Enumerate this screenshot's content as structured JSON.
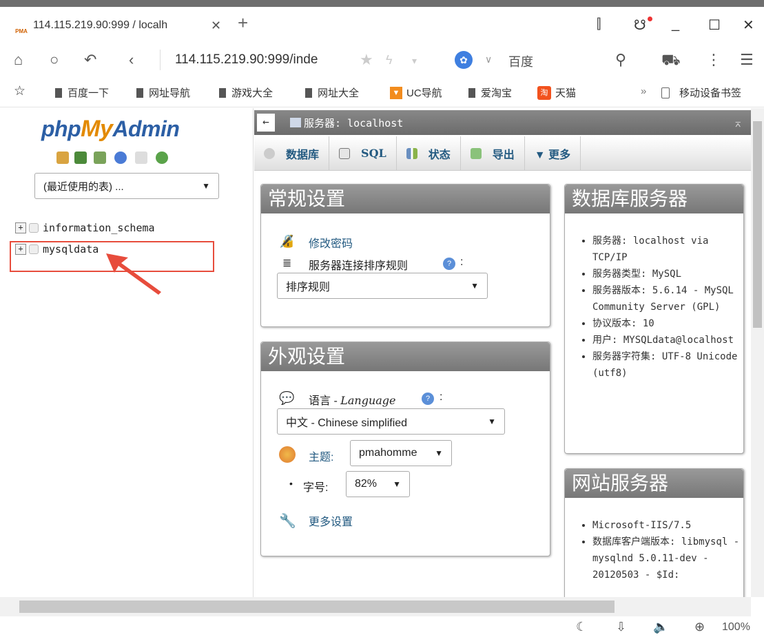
{
  "browser": {
    "tab_title": "114.115.219.90:999 / localh",
    "tab_favicon_text": "PMA",
    "url": "114.115.219.90:999/inde",
    "search_engine": "百度",
    "bookmarks": [
      "百度一下",
      "网址导航",
      "游戏大全",
      "网址大全",
      "UC导航",
      "爱淘宝",
      "天猫"
    ],
    "bookmarks_more": "»",
    "mobile_bookmarks": "移动设备书签",
    "zoom": "100%"
  },
  "sidebar": {
    "logo_php": "php",
    "logo_my": "My",
    "logo_admin": "Admin",
    "recent_tables": "(最近使用的表) ...",
    "databases": [
      "information_schema",
      "mysqldata"
    ]
  },
  "breadcrumb": {
    "back": "←",
    "server": "服务器: localhost"
  },
  "menu": {
    "tabs": [
      "数据库",
      "SQL",
      "状态",
      "导出"
    ],
    "more": "▼ 更多"
  },
  "general_settings": {
    "title": "常规设置",
    "change_password": "修改密码",
    "collation_label": "服务器连接排序规则",
    "collation_value": "排序规则"
  },
  "appearance_settings": {
    "title": "外观设置",
    "language_label": "语言 - ",
    "language_italic": "Language",
    "language_value": "中文 - Chinese simplified",
    "theme_label": "主题:",
    "theme_value": "pmahomme",
    "font_size_label": "字号:",
    "font_size_value": "82%",
    "more_settings": "更多设置"
  },
  "db_server": {
    "title": "数据库服务器",
    "items": [
      "服务器: localhost via TCP/IP",
      "服务器类型: MySQL",
      "服务器版本: 5.6.14 - MySQL Community Server (GPL)",
      "协议版本: 10",
      "用户: MYSQLdata@localhost",
      "服务器字符集: UTF-8 Unicode (utf8)"
    ]
  },
  "web_server": {
    "title": "网站服务器",
    "items": [
      "Microsoft-IIS/7.5",
      "数据库客户端版本: libmysql - mysqlnd 5.0.11-dev - 20120503 - $Id:"
    ]
  },
  "colors": {
    "pma_blue": "#235a81",
    "logo_orange": "#e38a00",
    "highlight_red": "#e74c3c"
  }
}
